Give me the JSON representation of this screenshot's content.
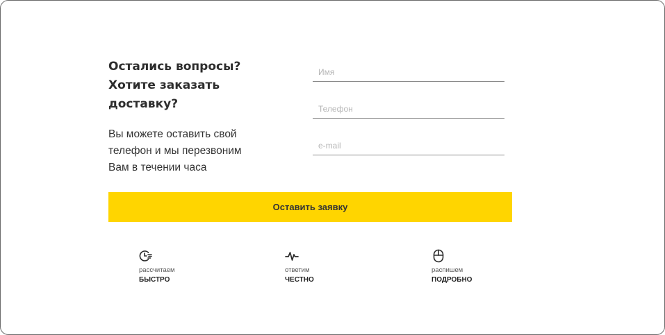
{
  "form": {
    "heading": "Остались вопросы?\nХотите заказать\nдоставку?",
    "description": "Вы можете оставить свой\nтелефон и мы перезвоним\nВам в течении часа",
    "fields": {
      "name_placeholder": "Имя",
      "phone_placeholder": "Телефон",
      "email_placeholder": "e-mail"
    },
    "submit_label": "Оставить заявку",
    "accent_color": "#FFD500"
  },
  "features": [
    {
      "icon": "fast-clock-icon",
      "caption": "рассчитаем",
      "emphasis": "БЫСТРО"
    },
    {
      "icon": "pulse-icon",
      "caption": "ответим",
      "emphasis": "ЧЕСТНО"
    },
    {
      "icon": "mouse-icon",
      "caption": "распишем",
      "emphasis": "ПОДРОБНО"
    }
  ]
}
